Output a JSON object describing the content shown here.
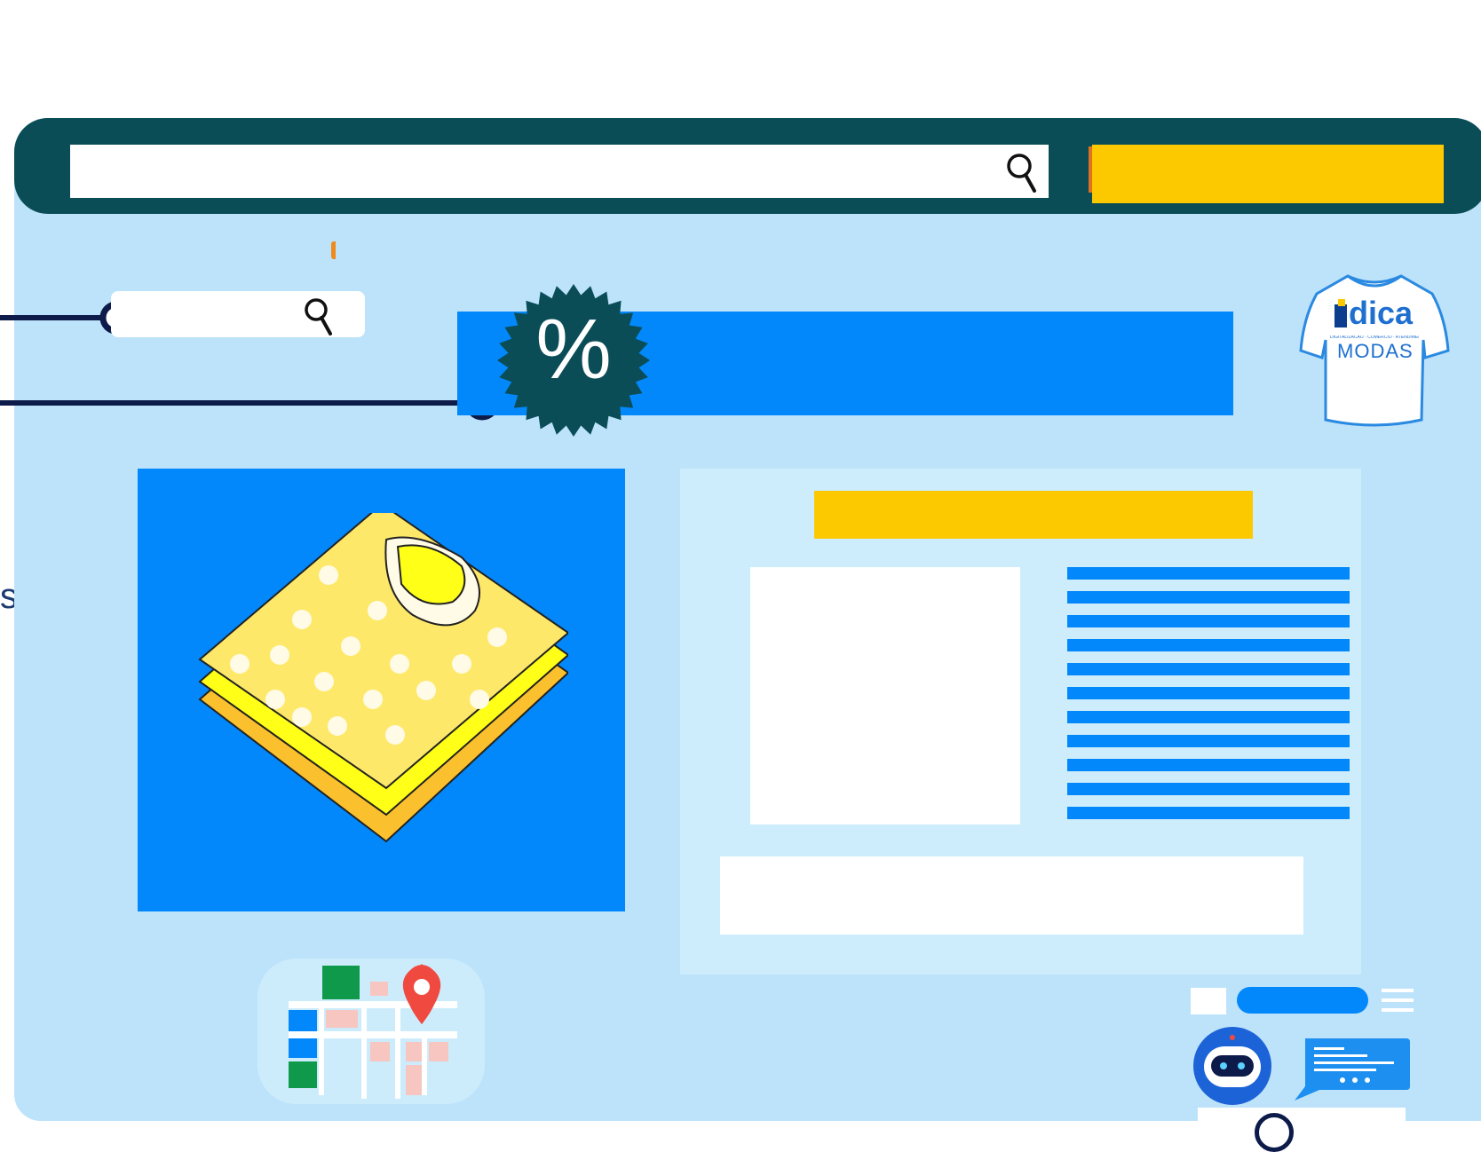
{
  "page": {
    "type": "e-commerce illustration",
    "browser_background": "#bde3fb",
    "topbar_color": "#0b4d57"
  },
  "header": {
    "search_icon": "search-icon",
    "cta_color": "#fcc800"
  },
  "connectors": {
    "color": "#0d1b4a",
    "mini_search_icon": "search-icon"
  },
  "promo": {
    "badge_text": "%",
    "badge_color": "#0b4d57",
    "banner_color": "#0288fa"
  },
  "logo": {
    "brand": "dica",
    "subtitle": "MODAS",
    "tagline": "DIGITALIZACAO · COMERCIO · ATENDIMENTO"
  },
  "product": {
    "icon": "folded-shirts-icon",
    "panel_color": "#0288fa"
  },
  "detail": {
    "title_color": "#fcc800",
    "stripe_count": 11,
    "stripe_color": "#0288fa"
  },
  "footer": {
    "map_icon": "map-pin-icon",
    "menu_icon": "hamburger-icon",
    "bot_icon": "robot-icon",
    "chat_icon": "chat-bubble-icon"
  },
  "side": {
    "letter": "s"
  }
}
